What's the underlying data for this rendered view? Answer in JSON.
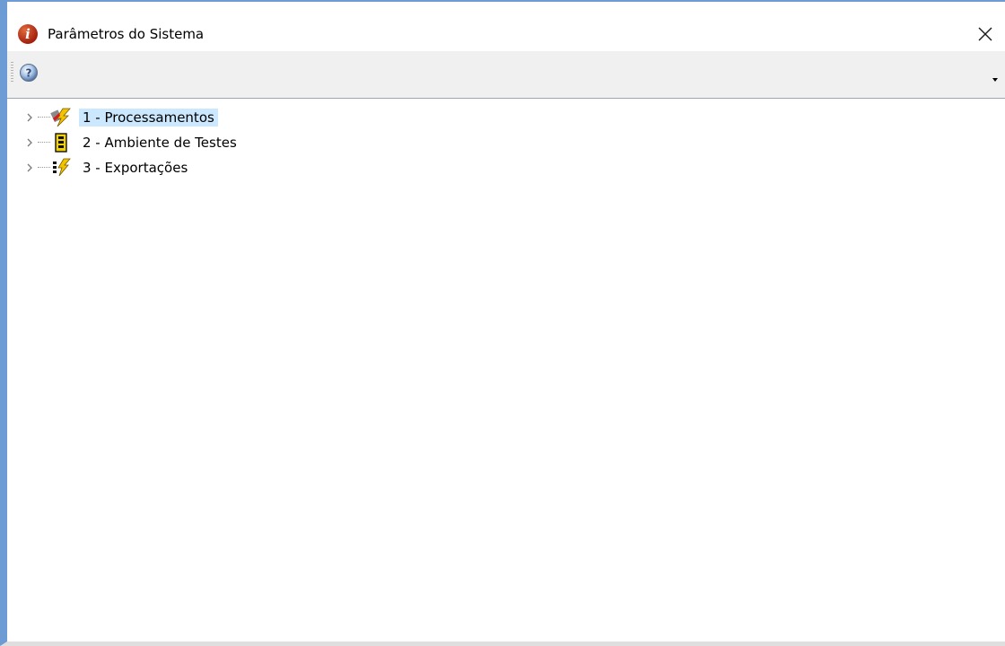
{
  "window": {
    "title": "Parâmetros do Sistema",
    "icon": "info-icon",
    "close_icon": "close-icon"
  },
  "toolbar": {
    "buttons": [
      {
        "icon": "help-icon"
      }
    ],
    "overflow_icon": "chevron-down-icon"
  },
  "tree": {
    "selected_index": 0,
    "items": [
      {
        "label": "1 - Processamentos",
        "icon": "processing-icon",
        "expanded": false
      },
      {
        "label": "2 - Ambiente de Testes",
        "icon": "test-environment-icon",
        "expanded": false
      },
      {
        "label": "3 - Exportações",
        "icon": "export-icon",
        "expanded": false
      }
    ]
  },
  "colors": {
    "frame_border": "#6d9bd4",
    "toolbar_bg": "#f0f0f0",
    "selection_bg": "#cce8ff",
    "app_icon": "#b83a1a"
  }
}
